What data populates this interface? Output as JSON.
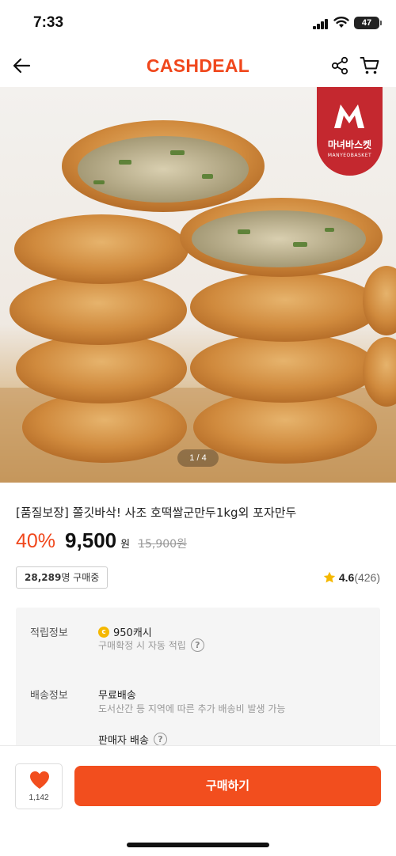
{
  "status_bar": {
    "time": "7:33",
    "battery": "47"
  },
  "header": {
    "brand": "CASHDEAL",
    "brand_color": "#f0471c",
    "back_icon": "arrow-left-icon",
    "share_icon": "share-icon",
    "cart_icon": "cart-icon"
  },
  "image": {
    "badge_name": "마녀바스켓",
    "badge_sub": "MANYEOBASKET",
    "counter": "1 / 4"
  },
  "product": {
    "title": "[품질보장] 쫄깃바삭! 사조 호떡쌀군만두1kg외 포자만두",
    "discount": "40%",
    "price": "9,500",
    "currency": "원",
    "original_price": "15,900원"
  },
  "stats": {
    "buyers_count": "28,289",
    "buyers_text": "명 구매중",
    "rating_score": "4.6",
    "rating_count": "(426)",
    "star_color": "#f5b800"
  },
  "info": {
    "reward_label": "적립정보",
    "reward_value": "950캐시",
    "reward_note": "구매확정 시 자동 적립",
    "shipping_label": "배송정보",
    "shipping_value": "무료배송",
    "shipping_note": "도서산간 등 지역에 따른 추가 배송비 발생 가능",
    "seller_shipping": "판매자 배송"
  },
  "bottom": {
    "like_count": "1,142",
    "buy_label": "구매하기",
    "buy_color": "#f24e1e"
  }
}
